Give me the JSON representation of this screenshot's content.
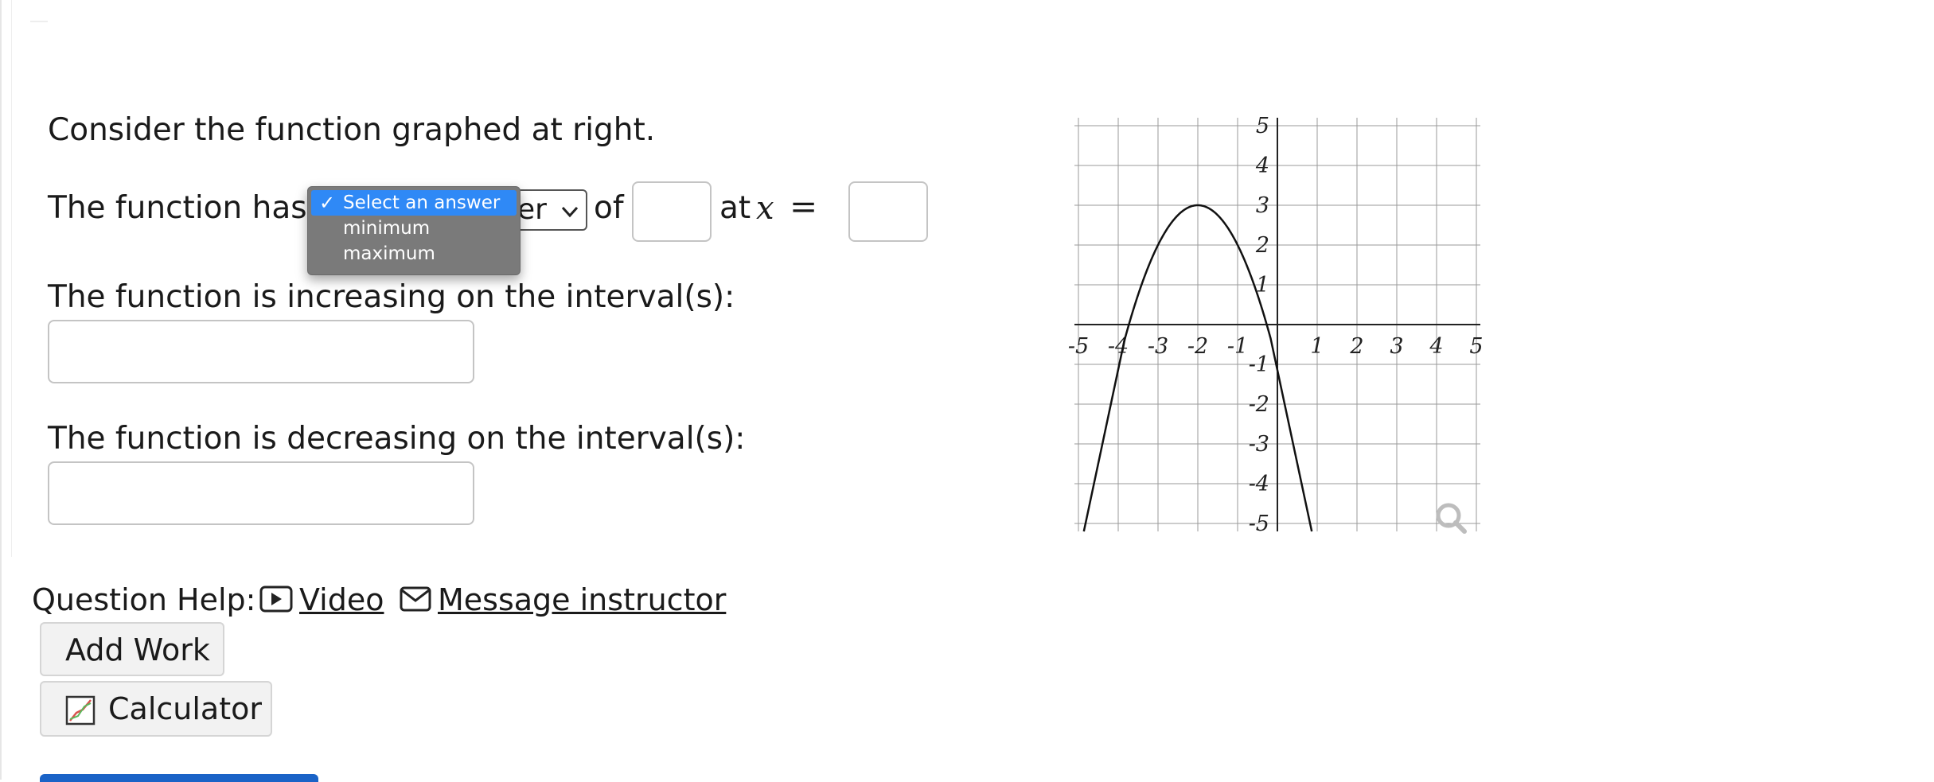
{
  "question": {
    "intro": "Consider the function graphed at right.",
    "extremum_prefix": "The function has a",
    "select_visible_fragment": "er",
    "of_label": "of",
    "at_label": "at",
    "x_var": "x",
    "equals": "=",
    "increasing_label": "The function is increasing on the interval(s):",
    "decreasing_label": "The function is decreasing on the interval(s):"
  },
  "dropdown": {
    "options": [
      {
        "label": "Select an answer",
        "selected": true
      },
      {
        "label": "minimum",
        "selected": false
      },
      {
        "label": "maximum",
        "selected": false
      }
    ],
    "check_glyph": "✓"
  },
  "inputs": {
    "extremum_value": "",
    "extremum_x": "",
    "increasing_intervals": "",
    "decreasing_intervals": ""
  },
  "help": {
    "label": "Question Help:",
    "video_link": "Video",
    "message_link": "Message instructor"
  },
  "buttons": {
    "add_work": "Add Work",
    "calculator": "Calculator"
  },
  "chart_data": {
    "type": "line",
    "x_ticks": [
      "-5",
      "-4",
      "-3",
      "-2",
      "-1",
      "1",
      "2",
      "3",
      "4",
      "5"
    ],
    "y_ticks": [
      "5",
      "4",
      "3",
      "2",
      "1",
      "-1",
      "-2",
      "-3",
      "-4",
      "-5"
    ],
    "xlim": [
      -5,
      5
    ],
    "ylim": [
      -5,
      5
    ],
    "grid": true,
    "series": [
      {
        "curve": "parabola opening downward, vertex (-2, 3), through (-4, -1) and (0, -1)",
        "x": [
          -5.4,
          -5,
          -4.5,
          -4,
          -3.5,
          -3,
          -2.5,
          -2,
          -1.5,
          -1,
          -0.5,
          0,
          0.5,
          1,
          1.4
        ],
        "y": [
          -8.56,
          -6,
          -3.25,
          -1,
          0.75,
          2,
          2.75,
          3,
          2.75,
          2,
          0.75,
          -1,
          -3.25,
          -6,
          -8.56
        ]
      }
    ]
  },
  "colors": {
    "dropdown_bg": "#7a7a7a",
    "dropdown_selected": "#2f89f6",
    "button_bg": "#f2f2f2",
    "link_text": "#1a1a1a",
    "accent_blue": "#1a63c7"
  },
  "icons": {
    "video": "video-play-icon",
    "message": "envelope-icon",
    "calculator": "calculator-graph-icon",
    "zoom": "magnifier-icon",
    "select_chevron": "chevron-down-icon"
  }
}
